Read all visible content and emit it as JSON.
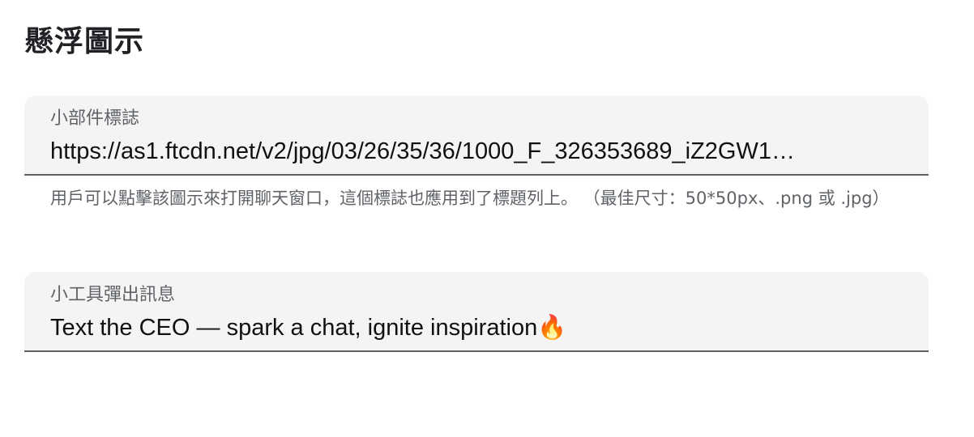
{
  "section": {
    "title": "懸浮圖示"
  },
  "widget_logo": {
    "label": "小部件標誌",
    "value": "https://as1.ftcdn.net/v2/jpg/03/26/35/36/1000_F_326353689_iZ2GW1…",
    "helper": "用戶可以點擊該圖示來打開聊天窗口，這個標誌也應用到了標題列上。 （最佳尺寸：50*50px、.png 或 .jpg）"
  },
  "widget_popup": {
    "label": "小工具彈出訊息",
    "value": "Text the CEO — spark a chat, ignite inspiration🔥"
  }
}
